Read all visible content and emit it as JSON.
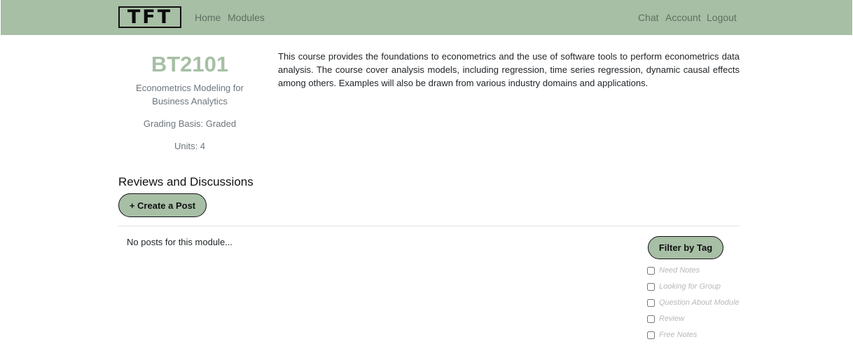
{
  "nav": {
    "logo_text": "TFT",
    "links_left": [
      "Home",
      "Modules"
    ],
    "links_right": [
      "Chat",
      "Account",
      "Logout"
    ]
  },
  "module": {
    "code": "BT2101",
    "title": "Econometrics Modeling for Business Analytics",
    "grading": "Grading Basis: Graded",
    "units": "Units: 4",
    "description": "This course provides the foundations to econometrics and the use of software tools to perform econometrics data analysis. The course cover analysis models, including regression, time series regression, dynamic causal effects among others. Examples will also be drawn from various industry domains and applications."
  },
  "discussions": {
    "heading": "Reviews and Discussions",
    "create_label": "+ Create a Post",
    "empty_text": "No posts for this module..."
  },
  "filter": {
    "button_label": "Filter by Tag",
    "tags": [
      "Need Notes",
      "Looking for Group",
      "Question About Module",
      "Review",
      "Free Notes"
    ]
  },
  "colors": {
    "accent": "#a7bfa5"
  }
}
